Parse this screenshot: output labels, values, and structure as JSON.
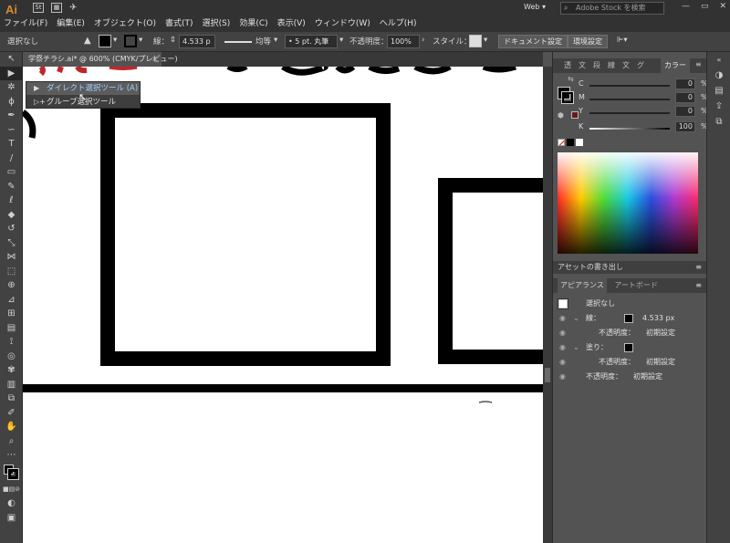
{
  "app": {
    "logo": "Ai",
    "bridge_label": "St",
    "workspace": "Web",
    "search_placeholder": "Adobe Stock を検索"
  },
  "menus": [
    "ファイル(F)",
    "編集(E)",
    "オブジェクト(O)",
    "書式(T)",
    "選択(S)",
    "効果(C)",
    "表示(V)",
    "ウィンドウ(W)",
    "ヘルプ(H)"
  ],
  "control_bar": {
    "selection": "選択なし",
    "stroke_label": "線：",
    "stroke_width": "4.533 p",
    "stroke_profile": "均等",
    "brush": "5 pt. 丸筆",
    "opacity_label": "不透明度：",
    "opacity_value": "100%",
    "style_label": "スタイル：",
    "doc_settings": "ドキュメント設定",
    "preferences": "環境設定"
  },
  "document_tab": {
    "title": "学祭チラシ.ai* @ 600% (CMYK/プレビュー)",
    "close": "×"
  },
  "tool_flyout": {
    "direct_selection": "ダイレクト選択ツール (A)",
    "group_selection": "グループ選択ツール"
  },
  "color_panel": {
    "tabs": [
      "透",
      "文",
      "段",
      "線",
      "文",
      "グ",
      "カラー"
    ],
    "sliders": [
      {
        "label": "C",
        "value": "0",
        "unit": "%"
      },
      {
        "label": "M",
        "value": "0",
        "unit": "%"
      },
      {
        "label": "Y",
        "value": "0",
        "unit": "%"
      },
      {
        "label": "K",
        "value": "100",
        "unit": "%"
      }
    ]
  },
  "asset_export_panel": {
    "title": "アセットの書き出し"
  },
  "appearance_panel": {
    "tabs": [
      "アピアランス",
      "アートボード"
    ],
    "rows": {
      "header": "選択なし",
      "stroke_label": "線：",
      "stroke_value": "4.533 px",
      "stroke_opacity_label": "不透明度：",
      "stroke_opacity_value": "初期設定",
      "fill_label": "塗り：",
      "fill_opacity_label": "不透明度：",
      "fill_opacity_value": "初期設定",
      "obj_opacity_label": "不透明度：",
      "obj_opacity_value": "初期設定"
    }
  },
  "colors": {
    "accent_logo": "#d98a2b",
    "flyout_highlight": "#9fd1ff",
    "artwork_red": "#c0262c",
    "artwork_black": "#000000"
  }
}
